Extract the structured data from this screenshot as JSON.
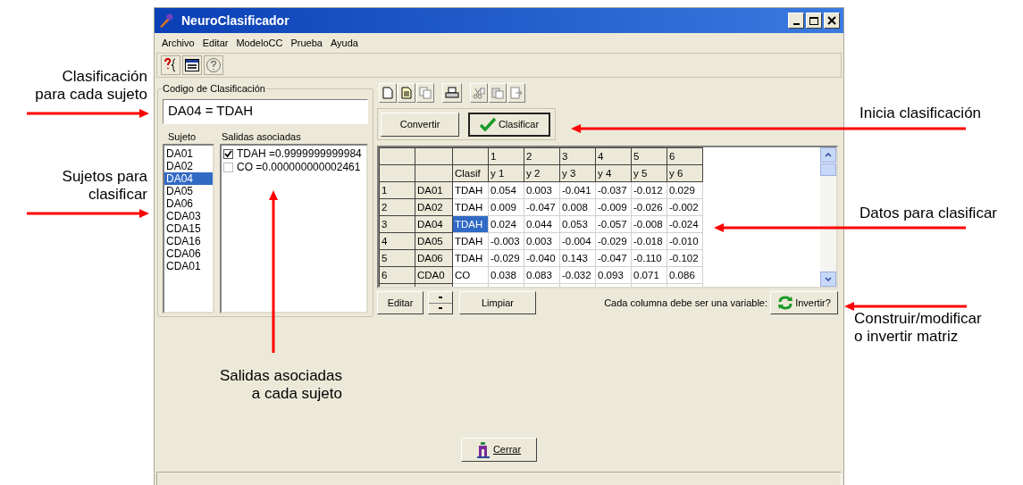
{
  "window": {
    "title": "NeuroClasificador"
  },
  "menu": [
    "Archivo",
    "Editar",
    "ModeloCC",
    "Prueba",
    "Ayuda"
  ],
  "classification": {
    "legend": "Codigo de Clasificación",
    "value": "DA04 = TDAH",
    "subjects_label": "Sujeto",
    "outputs_label": "Salidas asociadas"
  },
  "subjects": [
    {
      "label": "DA01",
      "selected": false
    },
    {
      "label": "DA02",
      "selected": false
    },
    {
      "label": "DA04",
      "selected": true
    },
    {
      "label": "DA05",
      "selected": false
    },
    {
      "label": "DA06",
      "selected": false
    },
    {
      "label": "CDA03",
      "selected": false
    },
    {
      "label": "CDA15",
      "selected": false
    },
    {
      "label": "CDA16",
      "selected": false
    },
    {
      "label": "CDA06",
      "selected": false
    },
    {
      "label": "CDA01",
      "selected": false
    }
  ],
  "outputs": [
    {
      "label": "TDAH =0.9999999999984",
      "checked": true
    },
    {
      "label": "CO =0.000000000002461",
      "checked": false
    }
  ],
  "actions": [
    "Convertir",
    "Clasificar"
  ],
  "grid": {
    "class_header": "Clasif",
    "columns": [
      {
        "index": "1",
        "name": "y 1"
      },
      {
        "index": "2",
        "name": "y 2"
      },
      {
        "index": "3",
        "name": "y 3"
      },
      {
        "index": "4",
        "name": "y 4"
      },
      {
        "index": "5",
        "name": "y 5"
      },
      {
        "index": "6",
        "name": "y 6"
      }
    ],
    "rows": [
      {
        "number": "1",
        "subject": "DA01",
        "class": "TDAH",
        "selected": false,
        "values": [
          "0.054",
          "0.003",
          "-0.041",
          "-0.037",
          "-0.012",
          "0.029"
        ]
      },
      {
        "number": "2",
        "subject": "DA02",
        "class": "TDAH",
        "selected": false,
        "values": [
          "0.009",
          "-0.047",
          "0.008",
          "-0.009",
          "-0.026",
          "-0.002"
        ]
      },
      {
        "number": "3",
        "subject": "DA04",
        "class": "TDAH",
        "selected": true,
        "values": [
          "0.024",
          "0.044",
          "0.053",
          "-0.057",
          "-0.008",
          "-0.024"
        ]
      },
      {
        "number": "4",
        "subject": "DA05",
        "class": "TDAH",
        "selected": false,
        "values": [
          "-0.003",
          "0.003",
          "-0.004",
          "-0.029",
          "-0.018",
          "-0.010"
        ]
      },
      {
        "number": "5",
        "subject": "DA06",
        "class": "TDAH",
        "selected": false,
        "values": [
          "-0.029",
          "-0.040",
          "0.143",
          "-0.047",
          "-0.110",
          "-0.102"
        ]
      },
      {
        "number": "6",
        "subject": "CDA0",
        "class": "CO",
        "selected": false,
        "values": [
          "0.038",
          "0.083",
          "-0.032",
          "0.093",
          "0.071",
          "0.086"
        ]
      }
    ]
  },
  "grid_buttons": {
    "edit": "Editar",
    "clear": "Limpiar",
    "hint": "Cada columna debe ser una variable:",
    "invert": "Invertir?"
  },
  "close_button": "Cerrar",
  "annotations": [
    {
      "lines": [
        "Clasificación",
        "para cada sujeto"
      ]
    },
    {
      "lines": [
        "Sujetos para",
        "clasificar"
      ]
    },
    {
      "lines": [
        "Salidas asociadas",
        "a cada sujeto"
      ]
    },
    {
      "lines": [
        "Inicia clasificación"
      ]
    },
    {
      "lines": [
        "Datos para clasificar"
      ]
    },
    {
      "lines": [
        "Construir/modificar",
        "o invertir matriz"
      ]
    }
  ]
}
